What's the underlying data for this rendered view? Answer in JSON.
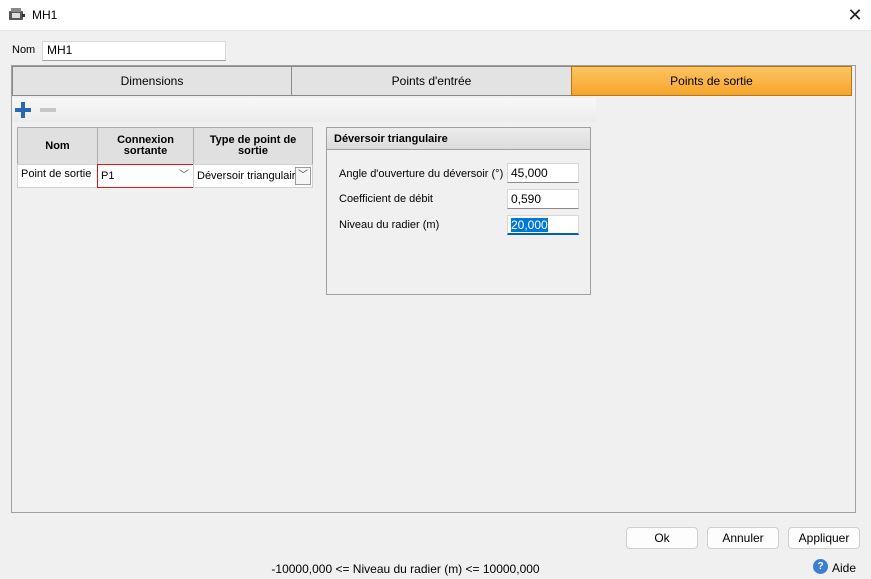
{
  "window": {
    "title": "MH1",
    "icon": "manhole-app-icon",
    "close_icon": "close-icon"
  },
  "name_field": {
    "label": "Nom",
    "value": "MH1"
  },
  "tabs": [
    {
      "label": "Dimensions",
      "active": false
    },
    {
      "label": "Points d'entrée",
      "active": false
    },
    {
      "label": "Points de sortie",
      "active": true
    }
  ],
  "toolbar": {
    "add_icon": "plus-icon",
    "remove_icon": "minus-icon"
  },
  "grid": {
    "columns": [
      "Nom",
      "Connexion sortante",
      "Type de point de sortie"
    ],
    "rows": [
      {
        "name": "Point de sortie",
        "connection": "P1",
        "type": "Déversoir triangulaire"
      }
    ]
  },
  "details": {
    "title": "Déversoir triangulaire",
    "fields": [
      {
        "label": "Angle d'ouverture du déversoir (°)",
        "value": "45,000"
      },
      {
        "label": "Coefficient de débit",
        "value": "0,590"
      },
      {
        "label": "Niveau du radier (m)",
        "value": "20,000"
      }
    ]
  },
  "buttons": {
    "ok": "Ok",
    "cancel": "Annuler",
    "apply": "Appliquer"
  },
  "status": {
    "text": "-10000,000 <= Niveau du radier (m) <= 10000,000"
  },
  "help": {
    "label": "Aide",
    "icon": "help-icon"
  },
  "colors": {
    "active_tab": "#f6a52a",
    "error_border": "#e11515",
    "selection": "#0078d7"
  }
}
